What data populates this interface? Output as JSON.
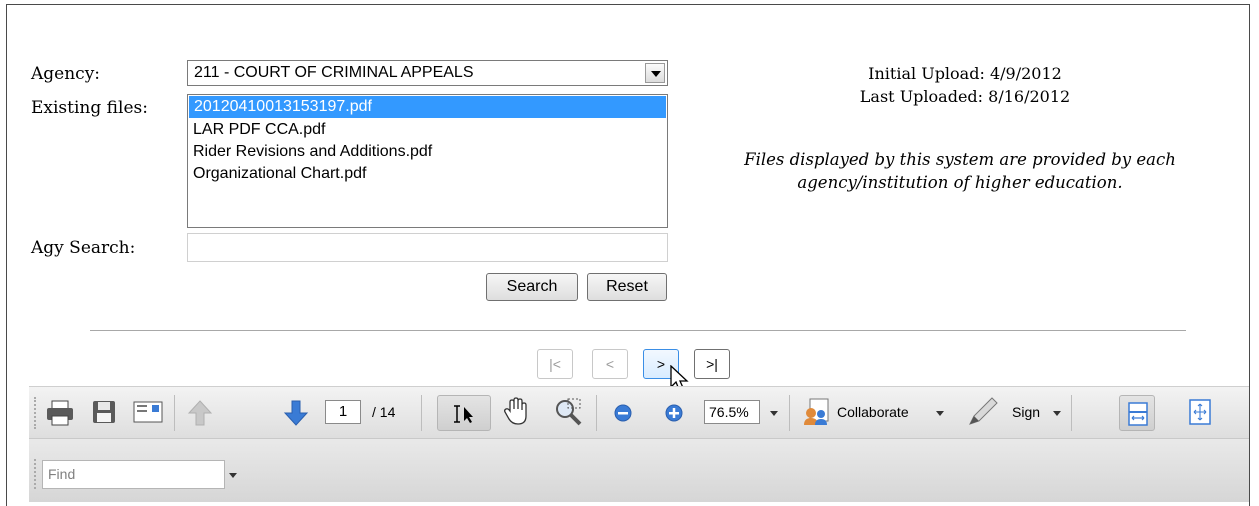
{
  "form": {
    "agency_label": "Agency:",
    "existing_files_label": "Existing files:",
    "agy_search_label": "Agy Search:",
    "agency_selected": "211 - COURT OF CRIMINAL APPEALS",
    "files": [
      "20120410013153197.pdf",
      "LAR PDF CCA.pdf",
      "Rider Revisions and Additions.pdf",
      "Organizational Chart.pdf"
    ],
    "search_value": "",
    "search_button": "Search",
    "reset_button": "Reset"
  },
  "info": {
    "initial_upload_label": "Initial Upload:",
    "initial_upload_date": "4/9/2012",
    "last_uploaded_label": "Last Uploaded:",
    "last_uploaded_date": "8/16/2012",
    "disclaimer_line1": "Files displayed by this system are provided by each",
    "disclaimer_line2": "agency/institution of higher education."
  },
  "pager": {
    "first": "|<",
    "prev": "<",
    "next": ">",
    "last": ">|"
  },
  "viewer": {
    "current_page": "1",
    "total_pages": "/ 14",
    "zoom": "76.5%",
    "collaborate_label": "Collaborate",
    "sign_label": "Sign",
    "find_placeholder": "Find"
  },
  "colors": {
    "selection": "#3399ff",
    "toolbar_bg": "#e6e6e6",
    "arrow_blue": "#3a7bd5"
  }
}
